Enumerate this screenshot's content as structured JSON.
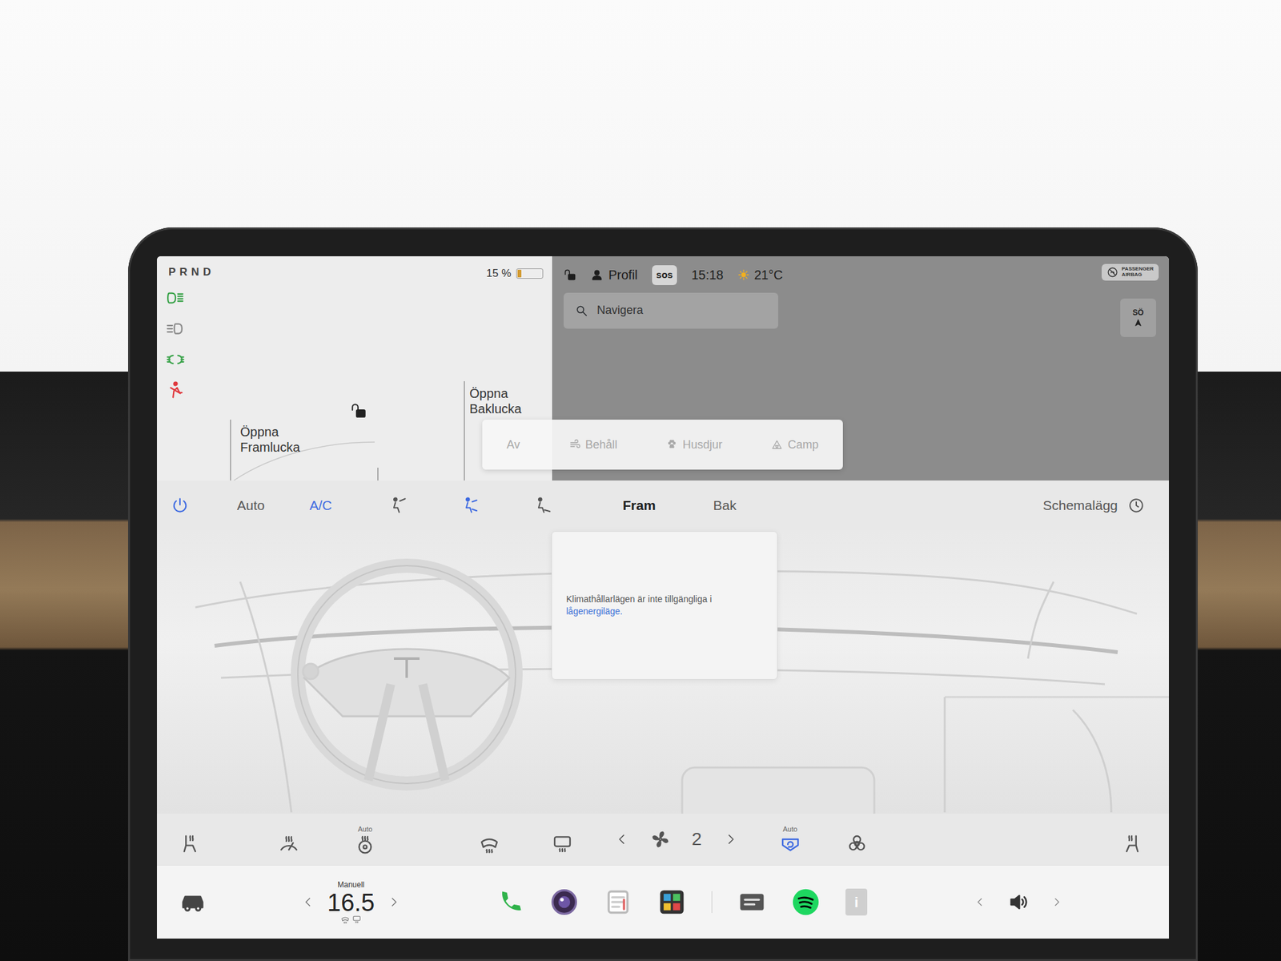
{
  "gear": "PRND",
  "battery": {
    "reading": "15 %",
    "level": 0.15
  },
  "indicators": [
    {
      "kind": "headlights",
      "color": "#3aa34a"
    },
    {
      "kind": "auto-high-beam",
      "color": "#8a8a8a"
    },
    {
      "kind": "parking-lights",
      "color": "#3aa34a"
    },
    {
      "kind": "seatbelt",
      "color": "#e0393e"
    }
  ],
  "car": {
    "locked": false,
    "frunk": [
      "Öppna",
      "Framlucka"
    ],
    "trunk": [
      "Öppna",
      "Baklucka"
    ]
  },
  "status_bar": {
    "locked": false,
    "profile": "Profil",
    "sos": "sos",
    "time": "15:18",
    "weather": "21°C",
    "airbag": [
      "PASSENGER",
      "AIRBAG"
    ]
  },
  "search": {
    "placeholder": "Navigera"
  },
  "compass": {
    "heading": "SÖ"
  },
  "keep_modes": [
    {
      "kind": "off",
      "label": "Av",
      "disabled": true
    },
    {
      "kind": "keep",
      "label": "Behåll",
      "disabled": true
    },
    {
      "kind": "dog",
      "label": "Husdjur",
      "disabled": true
    },
    {
      "kind": "camp",
      "label": "Camp",
      "disabled": true
    }
  ],
  "climate": {
    "power": {
      "on": true
    },
    "auto": {
      "label": "Auto",
      "on": false
    },
    "ac": {
      "label": "A/C",
      "on": true
    },
    "airflow": [
      {
        "selected": false
      },
      {
        "selected": true
      },
      {
        "selected": false
      }
    ],
    "zones": [
      {
        "label": "Fram",
        "selected": true
      },
      {
        "label": "Bak",
        "selected": false
      }
    ],
    "schedule": {
      "label": "Schemalägg"
    },
    "notice": {
      "text": "Klimathållarlägen är inte tillgängliga i",
      "link": "lågenergiläge."
    },
    "controls": [
      {
        "kind": "seat-heater-left",
        "on": false
      },
      {
        "kind": "wiper-heater",
        "on": false
      },
      {
        "kind": "steering-heater",
        "on": false,
        "label": "Auto"
      },
      {
        "kind": "defrost-front",
        "on": false
      },
      {
        "kind": "defrost-rear",
        "on": false
      },
      {
        "kind": "fan",
        "value": "2"
      },
      {
        "kind": "recirculation",
        "on": true,
        "label": "Auto"
      },
      {
        "kind": "bioweapon",
        "on": false
      },
      {
        "kind": "seat-heater-right",
        "on": false
      }
    ]
  },
  "taskbar": {
    "temp_mode": "Manuell",
    "temperature": "16.5",
    "apps": [
      {
        "kind": "phone"
      },
      {
        "kind": "camera"
      },
      {
        "kind": "calendar"
      },
      {
        "kind": "toybox"
      },
      {
        "kind": "dashcam"
      },
      {
        "kind": "spotify"
      },
      {
        "kind": "manual",
        "label": "i"
      }
    ],
    "volume": {
      "muted": false
    }
  }
}
